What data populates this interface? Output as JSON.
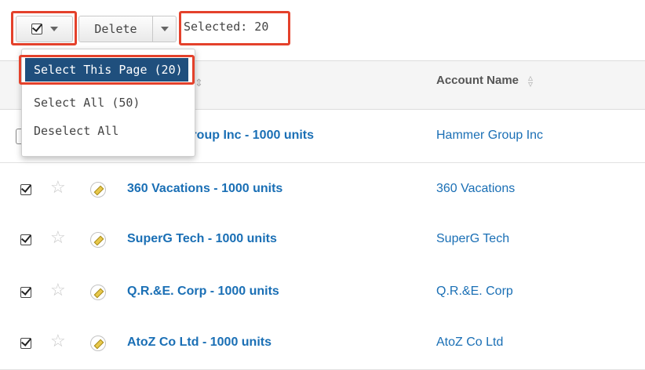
{
  "toolbar": {
    "select_icon": "checkbox-checked-icon",
    "delete_label": "Delete",
    "selected_label": "Selected: 20"
  },
  "menu": {
    "items": [
      {
        "label": "Select This Page (20)",
        "active": true
      },
      {
        "label": "Select All (50)",
        "active": false
      },
      {
        "label": "Deselect All",
        "active": false
      }
    ]
  },
  "table": {
    "columns": {
      "account_name": "Account Name"
    },
    "rows": [
      {
        "name": "Group Inc - 1000 units",
        "account": "Hammer Group Inc"
      },
      {
        "name": "360 Vacations - 1000 units",
        "account": "360 Vacations",
        "checked": true
      },
      {
        "name": "SuperG Tech - 1000 units",
        "account": "SuperG Tech",
        "checked": true
      },
      {
        "name": "Q.R.&E. Corp - 1000 units",
        "account": "Q.R.&E. Corp",
        "checked": true
      },
      {
        "name": "AtoZ Co Ltd - 1000 units",
        "account": "AtoZ Co Ltd",
        "checked": true
      }
    ]
  },
  "colors": {
    "highlight": "#e4412b",
    "link": "#1a6fb5",
    "menu_active": "#1f4f7d"
  }
}
